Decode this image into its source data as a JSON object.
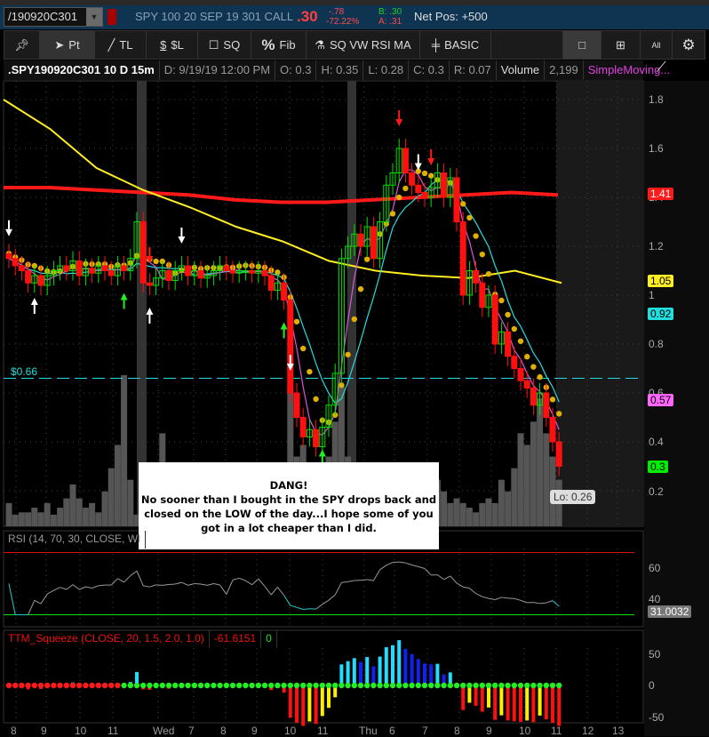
{
  "symbar": {
    "symbol": "/190920C301",
    "description": "SPY 100 20 SEP 19 301 CALL",
    "last": ".30",
    "change": "-.78",
    "change_pct": "-72.22%",
    "bid": "B: .30",
    "ask": "A: .31",
    "net_pos": "Net Pos: +500"
  },
  "toolbar": {
    "pt": "Pt",
    "tl": "TL",
    "sl": "$L",
    "sq": "SQ",
    "fib": "Fib",
    "studies": "SQ VW RSI MA",
    "style": "BASIC",
    "all": "All"
  },
  "header": {
    "symbol": ".SPY190920C301 10 D 15m",
    "date": "D: 9/19/19 12:00 PM",
    "open": "O: 0.3",
    "high": "H: 0.35",
    "low": "L: 0.28",
    "close": "C: 0.3",
    "range": "R: 0.07",
    "volume_label": "Volume",
    "volume": "2,199",
    "study": "SimpleMoving..."
  },
  "price_axis": [
    "1.8",
    "1.6",
    "1.4",
    "1.2",
    "1",
    "0.8",
    "0.6",
    "0.4",
    "0.2"
  ],
  "price_tags": {
    "red": "1.41",
    "yellow": "1.05",
    "cyan": "0.92",
    "magenta": "0.57",
    "green": "0.3"
  },
  "line_label": "$0.66",
  "lo_label": "Lo: 0.26",
  "note": {
    "title": "DANG!",
    "body": "No sooner than I bought in the SPY drops back and closed on the LOW of the day...I hope some of you got in a lot cheaper than I did."
  },
  "rsi": {
    "title": "RSI (14, 70, 30, CLOSE, WI",
    "value": "31.0032",
    "axis": [
      "60",
      "40"
    ]
  },
  "ttm": {
    "title": "TTM_Squeeze (CLOSE, 20, 1.5, 2.0, 1.0)",
    "value": "-61.6151",
    "zero": "0",
    "axis": [
      "50",
      "0",
      "-50"
    ]
  },
  "x_axis": [
    "8",
    "9",
    "10",
    "11",
    "Wed",
    "7",
    "8",
    "9",
    "10",
    "11",
    "Thu",
    "6",
    "7",
    "8",
    "9",
    "10",
    "11",
    "12",
    "13"
  ],
  "colors": {
    "up": "#00e000",
    "down": "#ff1010",
    "red_ma": "#ff1a1a",
    "yellow_ma": "#ffee22",
    "cyan_ma": "#22dddd",
    "magenta_ma": "#dd55dd",
    "dots": "#e0b000"
  },
  "chart_data": {
    "type": "candlestick",
    "closes": [
      1.15,
      1.12,
      1.1,
      1.05,
      1.08,
      1.04,
      1.08,
      1.1,
      1.12,
      1.1,
      1.14,
      1.08,
      1.11,
      1.09,
      1.12,
      1.1,
      1.08,
      1.12,
      1.1,
      1.15,
      1.3,
      1.05,
      1.04,
      1.07,
      1.1,
      1.06,
      1.1,
      1.12,
      1.08,
      1.1,
      1.07,
      1.08,
      1.1,
      1.12,
      1.1,
      1.09,
      1.1,
      1.1,
      1.09,
      1.1,
      1.08,
      1.02,
      1.05,
      0.98,
      0.6,
      0.5,
      0.42,
      0.45,
      0.38,
      0.46,
      0.55,
      0.68,
      1.15,
      1.2,
      1.25,
      1.2,
      1.28,
      1.15,
      1.3,
      1.45,
      1.5,
      1.6,
      1.5,
      1.45,
      1.42,
      1.4,
      1.44,
      1.5,
      1.4,
      1.48,
      1.3,
      1.0,
      1.1,
      1.05,
      0.95,
      1.0,
      0.8,
      0.85,
      0.75,
      0.7,
      0.65,
      0.62,
      0.55,
      0.6,
      0.5,
      0.4,
      0.3
    ],
    "volumes": [
      10,
      5,
      6,
      6,
      8,
      6,
      10,
      5,
      8,
      12,
      18,
      12,
      8,
      10,
      6,
      15,
      25,
      35,
      65,
      20,
      5,
      5,
      5,
      25,
      40,
      12,
      18,
      5,
      25,
      10,
      8,
      6,
      10,
      6,
      8,
      10,
      8,
      6,
      10,
      10,
      12,
      18,
      10,
      8,
      60,
      30,
      35,
      20,
      8,
      12,
      30,
      45,
      60,
      30,
      25,
      15,
      20,
      10,
      12,
      8,
      10,
      15,
      12,
      8,
      6,
      10,
      12,
      20,
      15,
      10,
      12,
      10,
      8,
      6,
      10,
      12,
      10,
      20,
      15,
      25,
      40,
      35,
      45,
      55,
      40,
      30,
      20
    ],
    "red_ma": [
      1.44,
      1.44,
      1.43,
      1.42,
      1.41,
      1.39,
      1.38,
      1.38,
      1.39,
      1.4,
      1.41,
      1.42,
      1.41
    ],
    "yellow_ma": [
      1.8,
      1.68,
      1.52,
      1.43,
      1.36,
      1.28,
      1.22,
      1.14,
      1.1,
      1.08,
      1.07,
      1.1,
      1.05
    ],
    "signals": [
      {
        "i": 0,
        "type": "sell-white"
      },
      {
        "i": 4,
        "type": "buy-white"
      },
      {
        "i": 18,
        "type": "buy-green"
      },
      {
        "i": 22,
        "type": "sell-red"
      },
      {
        "i": 22,
        "type": "buy-white"
      },
      {
        "i": 27,
        "type": "sell-white"
      },
      {
        "i": 43,
        "type": "buy-green"
      },
      {
        "i": 44,
        "type": "sell-white"
      },
      {
        "i": 48,
        "type": "buy-white"
      },
      {
        "i": 49,
        "type": "buy-green"
      },
      {
        "i": 61,
        "type": "sell-red"
      },
      {
        "i": 64,
        "type": "sell-white"
      },
      {
        "i": 66,
        "type": "sell-red"
      }
    ],
    "ylim": [
      0.1,
      1.9
    ],
    "line_level": 0.66
  }
}
